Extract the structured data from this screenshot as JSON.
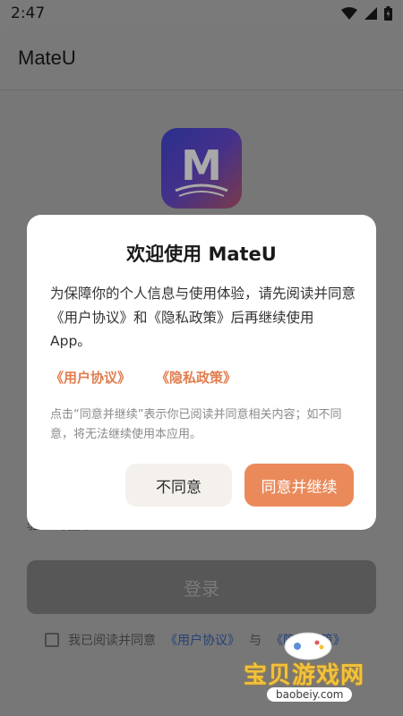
{
  "status_bar": {
    "time": "2:47"
  },
  "app_bar": {
    "title": "MateU"
  },
  "logo": {
    "letter": "M"
  },
  "background": {
    "hint_text": "验证码登录 ›",
    "login_label": "登录",
    "agree_prefix": "我已阅读并同意",
    "agree_link1": "《用户协议》",
    "agree_and": "与",
    "agree_link2": "《隐私政策》"
  },
  "dialog": {
    "title": "欢迎使用 MateU",
    "body": "为保障你的个人信息与使用体验，请先阅读并同意《用户协议》和《隐私政策》后再继续使用 App。",
    "link_user_agreement": "《用户协议》",
    "link_privacy_policy": "《隐私政策》",
    "note": "点击“同意并继续”表示你已阅读并同意相关内容；如不同意，将无法继续使用本应用。",
    "decline_label": "不同意",
    "accept_label": "同意并继续"
  },
  "watermark": {
    "text": "宝贝游戏网",
    "url": "baobeiy.com"
  },
  "colors": {
    "accent": "#ea8a5b",
    "link": "#e27d4e"
  }
}
